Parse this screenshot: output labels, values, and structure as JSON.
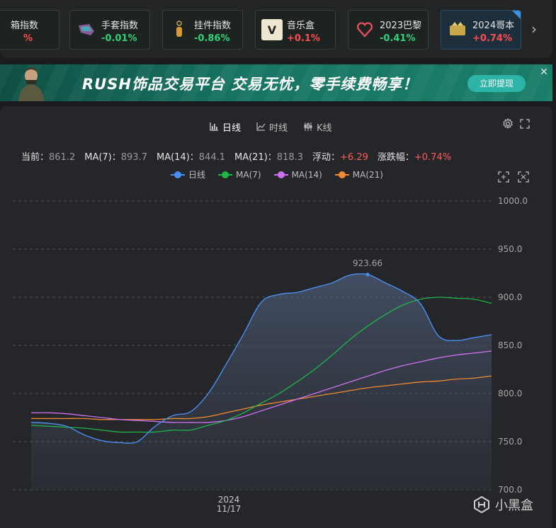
{
  "index_strip": {
    "cards": [
      {
        "name": "箱指数",
        "change": "%",
        "dir": "up",
        "icon": "box-icon"
      },
      {
        "name": "手套指数",
        "change": "-0.01%",
        "dir": "down",
        "icon": "glove-icon"
      },
      {
        "name": "挂件指数",
        "change": "-0.86%",
        "dir": "down",
        "icon": "charm-icon"
      },
      {
        "name": "音乐盒",
        "change": "+0.1%",
        "dir": "up",
        "icon": "music-box-icon"
      },
      {
        "name": "2023巴黎",
        "change": "-0.41%",
        "dir": "down",
        "icon": "paris-major-icon"
      },
      {
        "name": "2024哥本",
        "change": "+0.74%",
        "dir": "up",
        "icon": "copenhagen-major-icon"
      }
    ]
  },
  "banner": {
    "text": "RUSH饰品交易平台 交易无忧，零手续费畅享！",
    "button": "立即提现",
    "close": "✕"
  },
  "chart_panel": {
    "tabs": [
      {
        "label": "日线",
        "icon": "bar-chart-icon"
      },
      {
        "label": "时线",
        "icon": "line-chart-icon"
      },
      {
        "label": "K线",
        "icon": "candlestick-icon"
      }
    ],
    "stats": [
      {
        "key": "当前：",
        "value": "861.2"
      },
      {
        "key": "MA(7)：",
        "value": "893.7"
      },
      {
        "key": "MA(14)：",
        "value": "844.1"
      },
      {
        "key": "MA(21)：",
        "value": "818.3"
      },
      {
        "key": "浮动：",
        "value": "+6.29"
      },
      {
        "key": "涨跌幅：",
        "value": "+0.74%"
      }
    ]
  },
  "colors": {
    "daily": "#4a8ff0",
    "ma7": "#1fb547",
    "ma14": "#d070f0",
    "ma21": "#f08a30",
    "up": "#ff4d4f",
    "down": "#2fd27a"
  },
  "chart_data": {
    "type": "line",
    "xlabel": "",
    "ylabel": "",
    "x_tick_labels": [
      "2024",
      "11/17"
    ],
    "ylim": [
      700,
      1000
    ],
    "yticks": [
      "1000.0",
      "950.0",
      "900.0",
      "850.0",
      "800.0",
      "750.0",
      "700.0"
    ],
    "max_annotation": "923.66",
    "series": [
      {
        "name": "日线",
        "area": true,
        "values": [
          770,
          769,
          766,
          757,
          751,
          749,
          750,
          766,
          777,
          781,
          800,
          830,
          862,
          895,
          903,
          905,
          910,
          915,
          923,
          923.66,
          915,
          906,
          893,
          860,
          855,
          858,
          861.2
        ]
      },
      {
        "name": "MA(7)",
        "values": [
          767,
          766,
          765,
          764,
          762,
          760,
          760,
          760,
          762,
          762,
          767,
          772,
          780,
          790,
          800,
          812,
          825,
          840,
          856,
          870,
          882,
          892,
          898,
          900,
          899,
          898,
          893.7
        ]
      },
      {
        "name": "MA(14)",
        "values": [
          780,
          780,
          779,
          777,
          775,
          773,
          772,
          771,
          770,
          770,
          770,
          772,
          776,
          782,
          788,
          794,
          800,
          806,
          812,
          818,
          824,
          829,
          833,
          837,
          840,
          842,
          844.1
        ]
      },
      {
        "name": "MA(21)",
        "values": [
          774,
          774,
          774,
          774,
          773,
          773,
          773,
          773,
          774,
          774,
          776,
          780,
          784,
          788,
          791,
          794,
          797,
          800,
          803,
          806,
          808,
          810,
          812,
          813,
          815,
          816,
          818.3
        ]
      }
    ]
  },
  "watermark": "小黑盒"
}
